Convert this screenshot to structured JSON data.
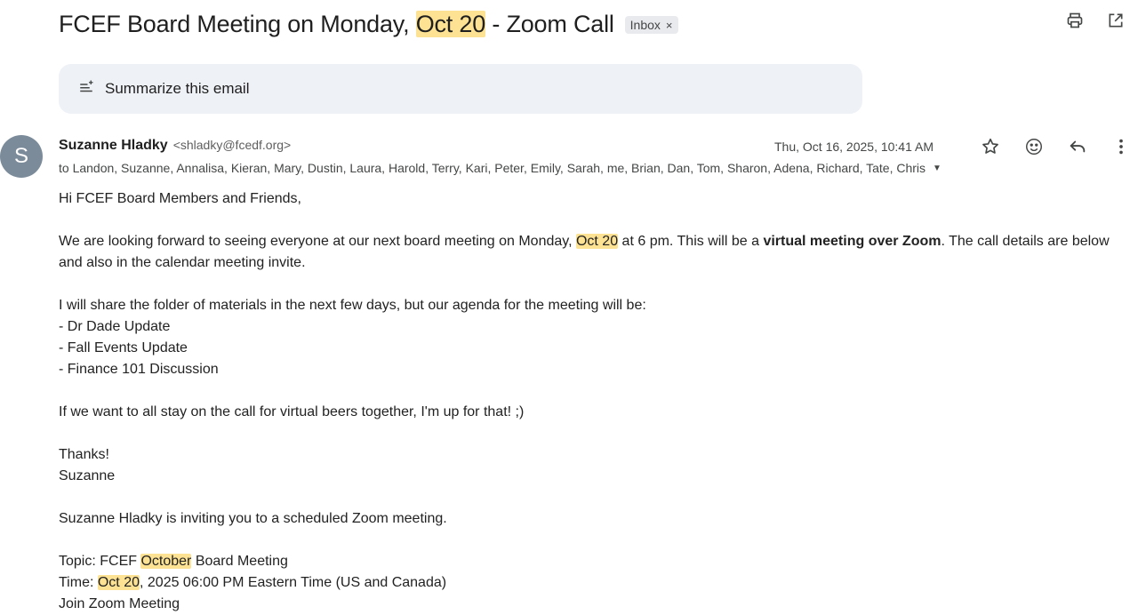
{
  "subject": {
    "before": "FCEF Board Meeting on Monday, ",
    "highlight": "Oct 20",
    "after": " - Zoom Call"
  },
  "label": {
    "text": "Inbox",
    "close": "×"
  },
  "toolbar_icons": [
    "print-icon",
    "open-in-new-window-icon"
  ],
  "summarize": {
    "label": "Summarize this email",
    "icon": "summarize-icon"
  },
  "sender": {
    "avatar_letter": "S",
    "avatar_color": "#7c8b9a",
    "name": "Suzanne Hladky",
    "email": "<shladky@fcedf.org>",
    "date": "Thu, Oct 16, 2025, 10:41 AM",
    "recipients": "to Landon, Suzanne, Annalisa, Kieran, Mary, Dustin, Laura, Harold, Terry, Kari, Peter, Emily, Sarah, me, Brian, Dan, Tom, Sharon, Adena, Richard, Tate, Chris"
  },
  "message_icons": [
    "star-icon",
    "emoji-icon",
    "reply-icon",
    "more-vert-icon"
  ],
  "body": {
    "greeting": "Hi FCEF Board Members and Friends,",
    "p1_a": "We are looking forward to seeing everyone at our next board meeting on Monday, ",
    "p1_hl": "Oct 20",
    "p1_b": " at 6 pm.  This will be a ",
    "p1_bold": "virtual meeting over Zoom",
    "p1_c": ".  The call details are below and also in the calendar meeting invite.",
    "agenda_intro": "I will share the folder of materials in the next few days, but our agenda for the meeting will be:",
    "agenda": [
      "- Dr Dade Update",
      "- Fall Events Update",
      "- Finance 101 Discussion"
    ],
    "beers": "If we want to all stay on the call for virtual beers together, I'm up for that!  ;)",
    "thanks": "Thanks!",
    "signoff": "Suzanne",
    "invite": "Suzanne Hladky is inviting you to a scheduled Zoom meeting.",
    "topic_a": "Topic: FCEF ",
    "topic_hl": "October",
    "topic_b": " Board Meeting",
    "time_a": "Time: ",
    "time_hl": "Oct 20",
    "time_b": ", 2025 06:00 PM Eastern Time (US and Canada)",
    "join": "Join Zoom Meeting"
  },
  "colors": {
    "highlight": "#fde293",
    "summarize_bg": "#eef1f6",
    "chip_bg": "#e9eaee"
  }
}
